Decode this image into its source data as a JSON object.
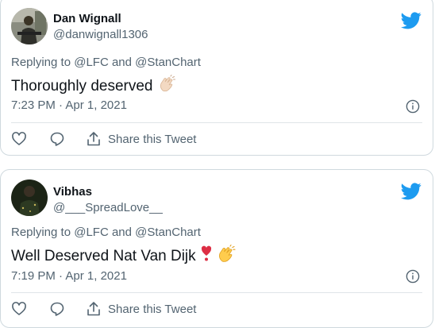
{
  "tweets": [
    {
      "author_name": "Dan Wignall",
      "handle": "@danwignall1306",
      "replying_prefix": "Replying to",
      "mention1": "@LFC",
      "conjunction": "and",
      "mention2": "@StanChart",
      "text": "Thoroughly deserved",
      "emoji_icon": "clapping-hands-icon",
      "time": "7:23 PM",
      "date": "Apr 1, 2021",
      "share_label": "Share this Tweet"
    },
    {
      "author_name": "Vibhas",
      "handle": "@___SpreadLove__",
      "replying_prefix": "Replying to",
      "mention1": "@LFC",
      "conjunction": "and",
      "mention2": "@StanChart",
      "text": "Well Deserved Nat Van Dijk",
      "emoji_icons": [
        "heart-exclamation-icon",
        "clapping-hands-icon"
      ],
      "time": "7:19 PM",
      "date": "Apr 1, 2021",
      "share_label": "Share this Tweet"
    }
  ],
  "colors": {
    "twitter_blue": "#1d9bf0",
    "secondary_text": "#536471",
    "border": "#cfd9de"
  }
}
